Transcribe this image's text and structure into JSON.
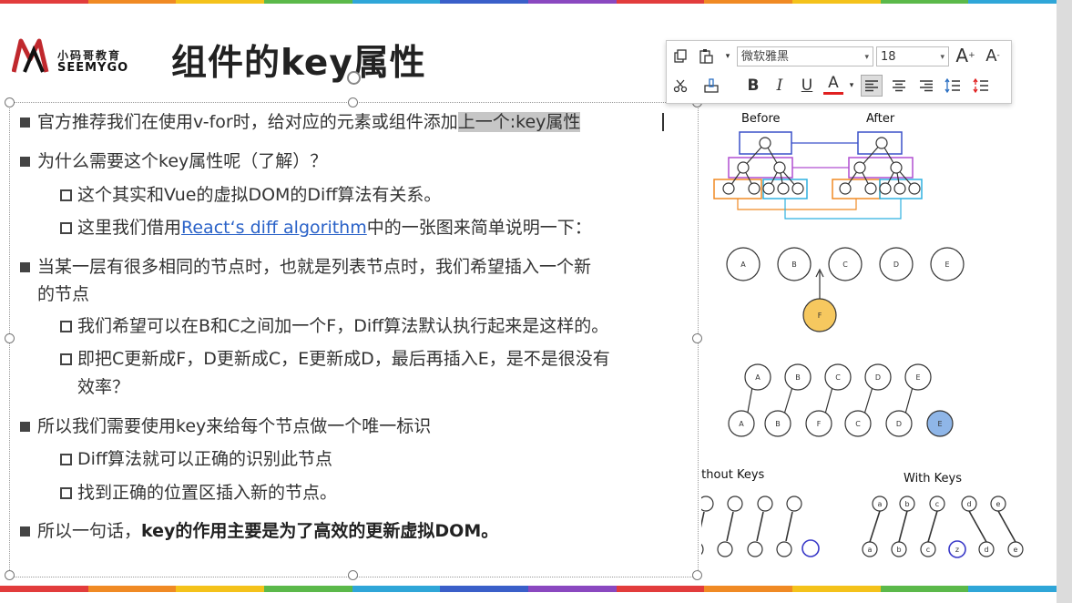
{
  "header": {
    "logo_cn": "小码哥教育",
    "logo_en": "SEEMYGO",
    "title": "组件的key属性"
  },
  "toolbar": {
    "font_name": "微软雅黑",
    "font_size": "18",
    "bold_label": "B",
    "italic_label": "I",
    "underline_label": "U",
    "font_color_label": "A",
    "grow_label": "A",
    "shrink_label": "A"
  },
  "content": {
    "l1_a": "官方推荐我们在使用v-for时，给对应的元素或组件添加",
    "l1_hl": "上一个:key属性",
    "l2": "为什么需要这个key属性呢（了解）？",
    "l3": "这个其实和Vue的虚拟DOM的Diff算法有关系。",
    "l4_a": "这里我们借用",
    "l4_link": "React‘s diff algorithm",
    "l4_b": "中的一张图来简单说明一下：",
    "l5a": "当某一层有很多相同的节点时，也就是列表节点时，我们希望插入一个新",
    "l5b": "的节点",
    "l6": "我们希望可以在B和C之间加一个F，Diff算法默认执行起来是这样的。",
    "l7a": "即把C更新成F，D更新成C，E更新成D，最后再插入E，是不是很没有",
    "l7b": "效率？",
    "l8": "所以我们需要使用key来给每个节点做一个唯一标识",
    "l9": "Diff算法就可以正确的识别此节点",
    "l10": "找到正确的位置区插入新的节点。",
    "l11_a": "所以一句话，",
    "l11_b": "key的作用主要是为了高效的更新虚拟DOM。"
  },
  "diagram": {
    "before_label": "Before",
    "after_label": "After",
    "row_nodes": [
      "A",
      "B",
      "C",
      "D",
      "E"
    ],
    "insert_node": "F",
    "old_nodes": [
      "A",
      "B",
      "C",
      "D",
      "E"
    ],
    "new_nodes": [
      "A",
      "B",
      "F",
      "C",
      "D",
      "E"
    ],
    "without_keys_label": "Without Keys",
    "with_keys_label": "With Keys",
    "with_keys_top": [
      "a",
      "b",
      "c",
      "d",
      "e"
    ],
    "with_keys_bottom": [
      "a",
      "b",
      "c",
      "z",
      "d",
      "e"
    ]
  },
  "colors": {
    "bar": [
      "#e23c3c",
      "#f08a24",
      "#f4c21b",
      "#5bb94a",
      "#2fa6d8",
      "#3a5fc9",
      "#8a48c0",
      "#e23c3c",
      "#f08a24",
      "#f4c21b",
      "#5bb94a",
      "#2fa6d8"
    ],
    "insert_fill": "#f6c85f",
    "highlight_fill": "#8fb6e8",
    "box_blue": "#3a50c9",
    "box_purple": "#b04fd0",
    "box_orange": "#f08a24",
    "box_cyan": "#2fb1e0"
  }
}
